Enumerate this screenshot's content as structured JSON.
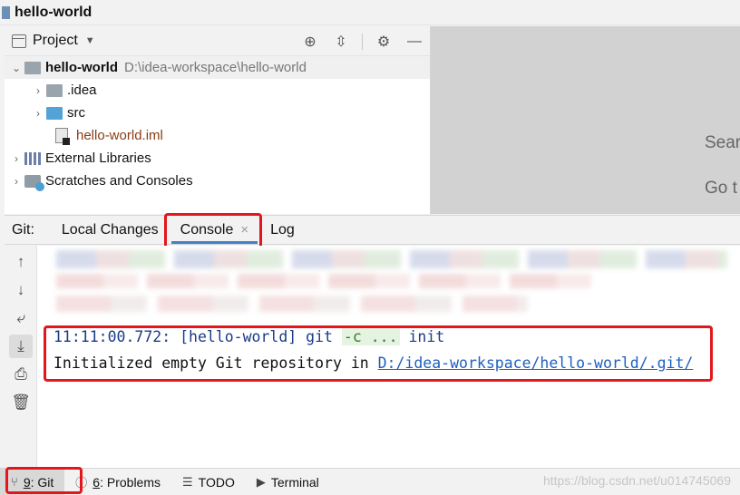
{
  "window": {
    "title": "hello-world"
  },
  "project_panel": {
    "header_label": "Project",
    "tree": [
      {
        "label": "hello-world",
        "path": "D:\\idea-workspace\\hello-world",
        "expanded": true
      },
      {
        "label": ".idea"
      },
      {
        "label": "src"
      },
      {
        "label": "hello-world.iml"
      },
      {
        "label": "External Libraries"
      },
      {
        "label": "Scratches and Consoles"
      }
    ]
  },
  "editor": {
    "hint_1": "Sear",
    "hint_2": "Go t"
  },
  "git_window": {
    "prefix": "Git:",
    "tabs": [
      {
        "label": "Local Changes"
      },
      {
        "label": "Console",
        "active": true
      },
      {
        "label": "Log"
      }
    ]
  },
  "console": {
    "line1": {
      "timestamp": "11:11:00.772:",
      "project": "[hello-world]",
      "cmd": "git",
      "arg": "-c ...",
      "sub": "init"
    },
    "line2": {
      "text": "Initialized empty Git repository in",
      "link": "D:/idea-workspace/hello-world/.git/"
    }
  },
  "statusbar": {
    "items": [
      {
        "num": "9",
        "label": ": Git",
        "active": true
      },
      {
        "num": "6",
        "label": ": Problems"
      },
      {
        "label": "TODO"
      },
      {
        "label": "Terminal"
      }
    ],
    "watermark": "https://blog.csdn.net/u014745069"
  },
  "colors": {
    "accent": "#4083c9",
    "highlight_box": "#e3171b",
    "link": "#1f5fbf"
  }
}
